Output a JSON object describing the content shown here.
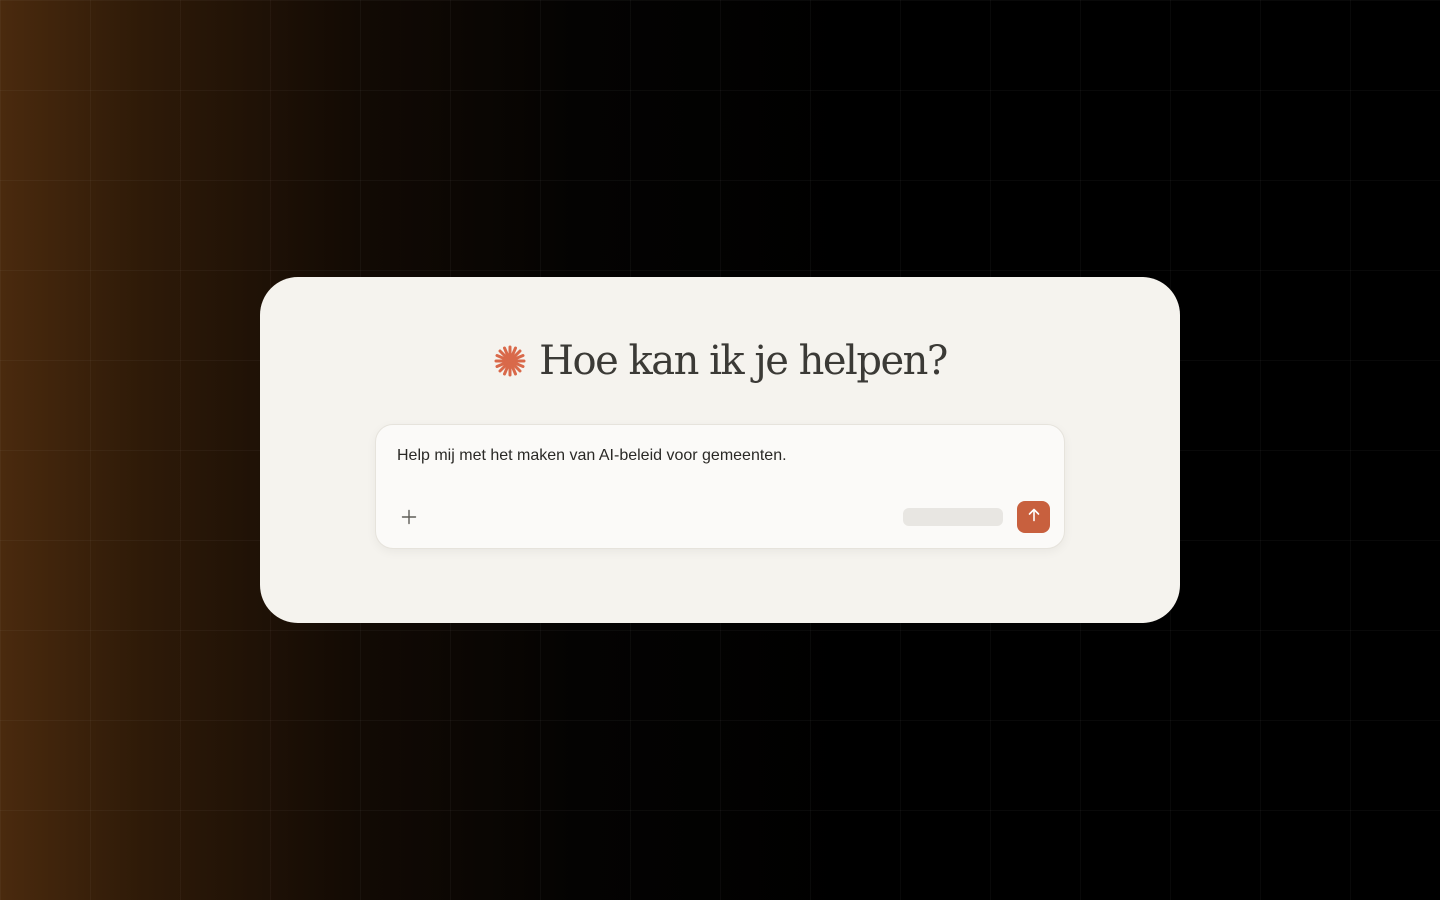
{
  "heading": {
    "title": "Hoe kan ik je helpen?",
    "icon": "sparkle-icon",
    "icon_color": "#d9694a"
  },
  "composer": {
    "value": "Help mij met het maken van AI-beleid voor gemeenten.",
    "add_icon": "plus-icon",
    "send_icon": "arrow-up-icon",
    "send_color": "#c8603e"
  },
  "colors": {
    "card_background": "#f5f3ee",
    "page_background_left": "#4a2a0e",
    "page_background_right": "#000000"
  }
}
